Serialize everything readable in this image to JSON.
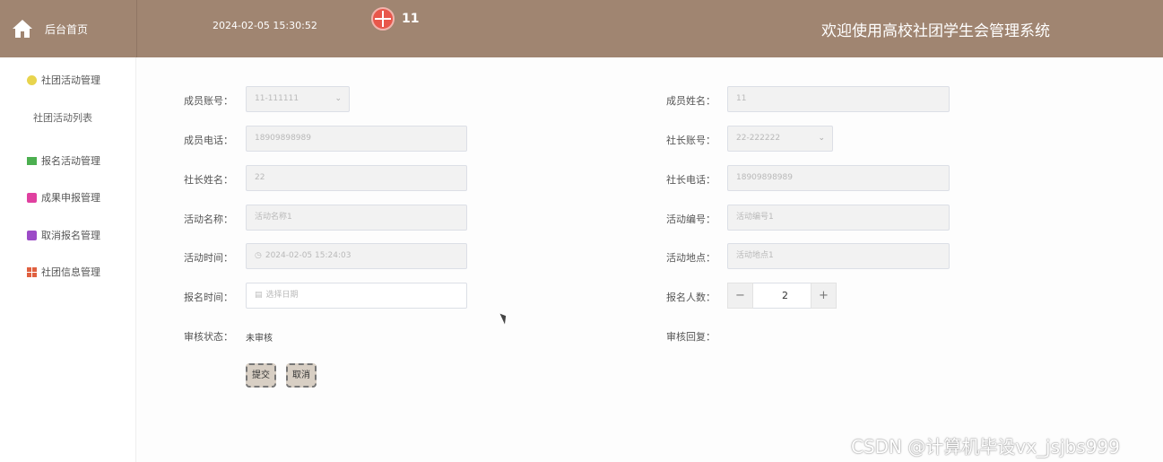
{
  "header": {
    "home_label": "后台首页",
    "datetime": "2024-02-05 15:30:52",
    "username": "11",
    "welcome": "欢迎使用高校社团学生会管理系统"
  },
  "sidebar": {
    "items": [
      {
        "label": "社团活动管理",
        "icon": "circle-icon",
        "color": "#e8d44d"
      },
      {
        "label": "报名活动管理",
        "icon": "chat-icon",
        "color": "#4caf50"
      },
      {
        "label": "成果申报管理",
        "icon": "doc-icon",
        "color": "#e040a0"
      },
      {
        "label": "取消报名管理",
        "icon": "box-icon",
        "color": "#9c4bc7"
      },
      {
        "label": "社团信息管理",
        "icon": "grid-icon",
        "color": "#e06040"
      }
    ],
    "submenu": "社团活动列表"
  },
  "form": {
    "member_account": {
      "label": "成员账号：",
      "value": "11-111111"
    },
    "member_name": {
      "label": "成员姓名：",
      "value": "11"
    },
    "member_phone": {
      "label": "成员电话：",
      "value": "18909898989"
    },
    "leader_account": {
      "label": "社长账号：",
      "value": "22-222222"
    },
    "leader_name": {
      "label": "社长姓名：",
      "value": "22"
    },
    "leader_phone": {
      "label": "社长电话：",
      "value": "18909898989"
    },
    "activity_name": {
      "label": "活动名称：",
      "value": "活动名称1"
    },
    "activity_code": {
      "label": "活动编号：",
      "value": "活动编号1"
    },
    "activity_time": {
      "label": "活动时间：",
      "value": "2024-02-05 15:24:03"
    },
    "activity_place": {
      "label": "活动地点：",
      "value": "活动地点1"
    },
    "signup_time": {
      "label": "报名时间：",
      "placeholder": "选择日期"
    },
    "signup_count": {
      "label": "报名人数：",
      "value": "2",
      "minus": "−",
      "plus": "+"
    },
    "review_status": {
      "label": "审核状态：",
      "value": "未审核"
    },
    "review_reply": {
      "label": "审核回复："
    },
    "submit": "提交",
    "cancel": "取消"
  },
  "watermark": "CSDN @计算机毕设vx_jsjbs999"
}
